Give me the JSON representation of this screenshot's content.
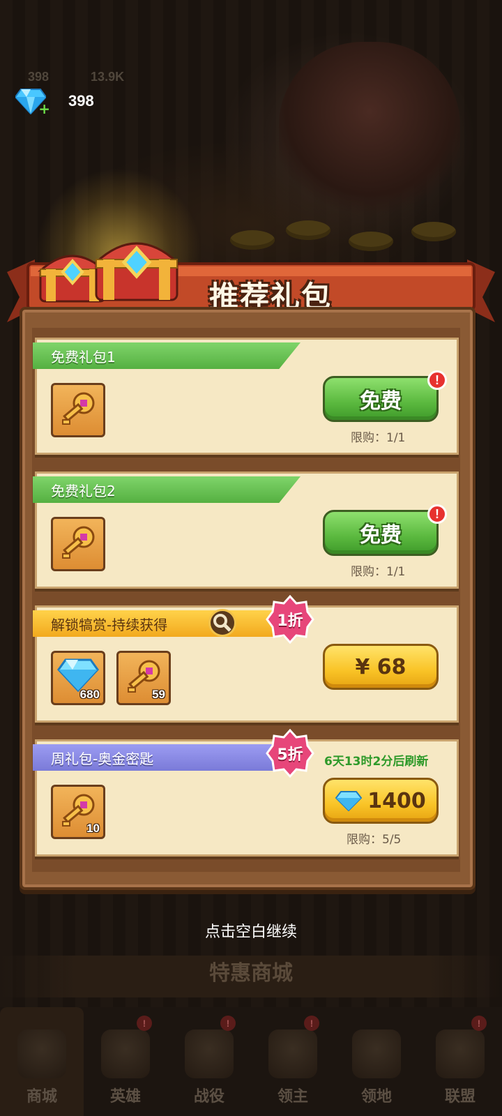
{
  "currency": {
    "gems": "398",
    "gold_faded": "13.9K",
    "gems_faded": "398"
  },
  "banner": {
    "title": "推荐礼包"
  },
  "packs": [
    {
      "title": "免费礼包1",
      "button": "免费",
      "limit": "限购：1/1",
      "alert": "!",
      "items": [
        {
          "icon": "key-icon",
          "count": ""
        }
      ]
    },
    {
      "title": "免费礼包2",
      "button": "免费",
      "limit": "限购：1/1",
      "alert": "!",
      "items": [
        {
          "icon": "key-icon",
          "count": ""
        }
      ]
    },
    {
      "title": "解锁犒赏-持续获得",
      "button": "¥ 68",
      "discount": "1折",
      "items": [
        {
          "icon": "gem-icon",
          "count": "680"
        },
        {
          "icon": "key-icon",
          "count": "59"
        }
      ]
    },
    {
      "title": "周礼包-奥金密匙",
      "button_price": "1400",
      "discount": "5折",
      "refresh": "6天13时2分后刷新",
      "limit": "限购：5/5",
      "items": [
        {
          "icon": "key-icon",
          "count": "10"
        }
      ]
    }
  ],
  "continue_hint": "点击空白继续",
  "shop_title": "特惠商城",
  "nav": [
    {
      "label": "商城",
      "icon": "shop-icon"
    },
    {
      "label": "英雄",
      "icon": "hero-cards-icon"
    },
    {
      "label": "战役",
      "icon": "battle-icon"
    },
    {
      "label": "领主",
      "icon": "lord-icon"
    },
    {
      "label": "领地",
      "icon": "castle-icon"
    },
    {
      "label": "联盟",
      "icon": "alliance-icon"
    }
  ],
  "colors": {
    "green_button": "#5ab83e",
    "yellow_button": "#f9c326",
    "card_bg": "#f6e8c4",
    "panel_wood": "#8a5a34",
    "refresh_text": "#2f9a2a"
  }
}
